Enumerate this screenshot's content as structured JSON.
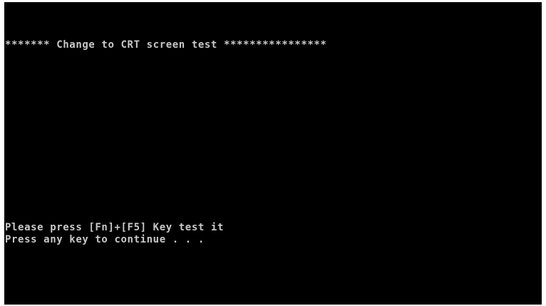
{
  "screen": {
    "background": "#000000",
    "text_color": "#c8c8c8",
    "title": "******* Change to CRT screen test ****************",
    "prompt": "Please press [Fn]+[F5] Key test it",
    "continue": "Press any key to continue . . ."
  }
}
